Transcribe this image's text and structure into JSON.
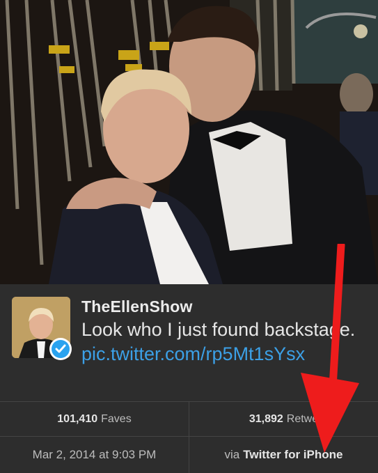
{
  "tweet": {
    "username": "TheEllenShow",
    "text_before_link": "Look who I just found backstage. ",
    "link_text": "pic.twitter.com/rp5Mt1sYsx"
  },
  "stats": {
    "faves_count": "101,410",
    "faves_label": "Faves",
    "retweets_count": "31,892",
    "retweets_label": "Retwe"
  },
  "meta": {
    "timestamp": "Mar 2, 2014 at 9:03 PM",
    "via_prefix": "via",
    "via_client": "Twitter for iPhone"
  },
  "colors": {
    "link": "#3ca0e6",
    "verified": "#2aa3ef",
    "annotation_arrow": "#ee1c1c"
  },
  "icons": {
    "verified": "verified-badge-icon",
    "arrow": "red-arrow-annotation"
  }
}
